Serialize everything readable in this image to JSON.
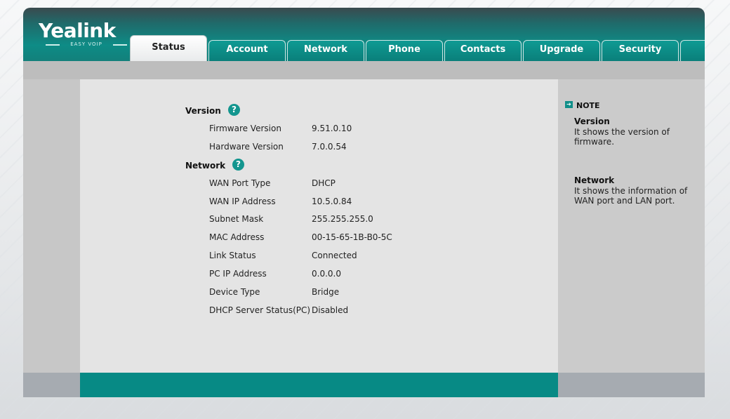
{
  "brand": {
    "name": "Yealink",
    "tagline": "EASY VOIP"
  },
  "tabs": [
    {
      "label": "Status",
      "active": true
    },
    {
      "label": "Account",
      "active": false
    },
    {
      "label": "Network",
      "active": false
    },
    {
      "label": "Phone",
      "active": false
    },
    {
      "label": "Contacts",
      "active": false
    },
    {
      "label": "Upgrade",
      "active": false
    },
    {
      "label": "Security",
      "active": false
    }
  ],
  "version": {
    "title": "Version",
    "help_icon": "question-icon",
    "rows": [
      {
        "label": "Firmware Version",
        "value": "9.51.0.10"
      },
      {
        "label": "Hardware Version",
        "value": "7.0.0.54"
      }
    ]
  },
  "network": {
    "title": "Network",
    "help_icon": "question-icon",
    "rows": [
      {
        "label": "WAN Port Type",
        "value": "DHCP"
      },
      {
        "label": "WAN IP Address",
        "value": "10.5.0.84"
      },
      {
        "label": "Subnet Mask",
        "value": "255.255.255.0"
      },
      {
        "label": "MAC Address",
        "value": "00-15-65-1B-B0-5C"
      },
      {
        "label": "Link Status",
        "value": "Connected"
      },
      {
        "label": "PC IP Address",
        "value": "0.0.0.0"
      },
      {
        "label": "Device Type",
        "value": "Bridge"
      },
      {
        "label": "DHCP Server Status(PC)",
        "value": "Disabled"
      }
    ]
  },
  "note": {
    "heading": "NOTE",
    "items": [
      {
        "title": "Version",
        "text": "It shows the version of firmware."
      },
      {
        "title": "Network",
        "text": "It shows the information of WAN port and LAN port."
      }
    ]
  },
  "colors": {
    "brand_teal": "#0e8c86",
    "footer_teal": "#078a85",
    "help_icon": "#13968f"
  }
}
